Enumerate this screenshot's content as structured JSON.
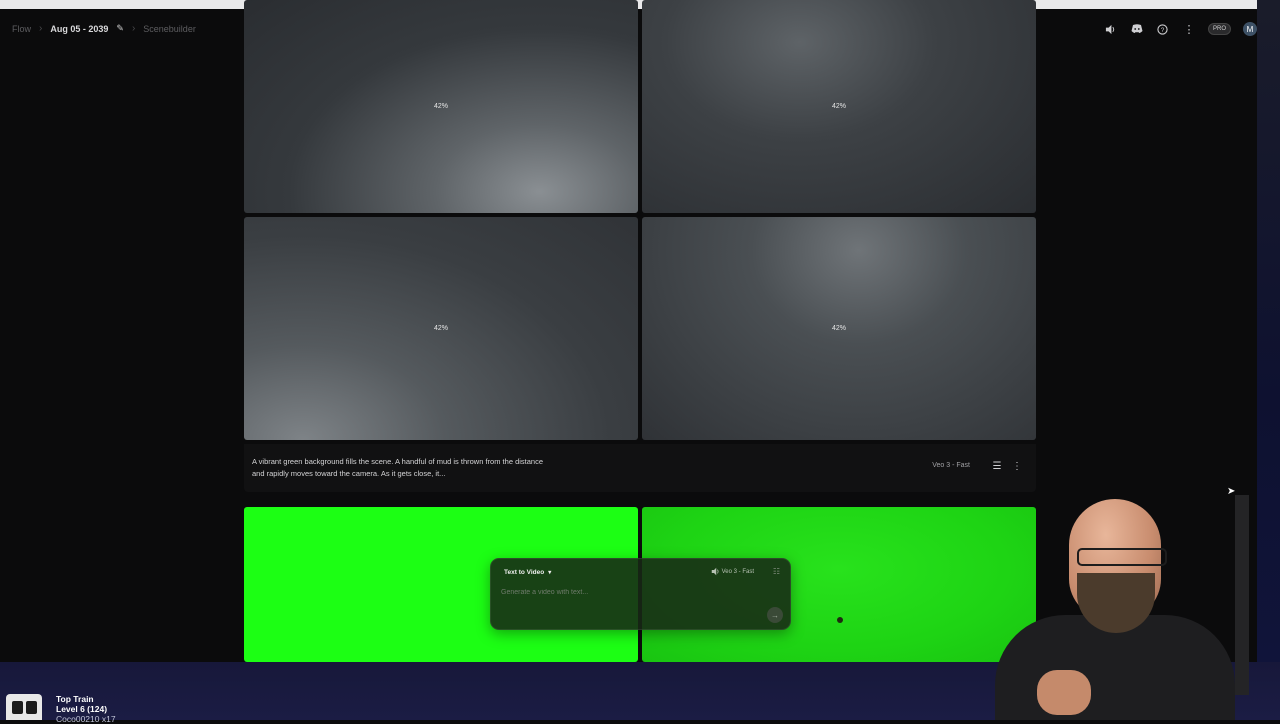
{
  "header": {
    "breadcrumb": [
      "Flow",
      "Aug 05 - 2039",
      "Scenebuilder"
    ],
    "pro_badge": "PRO",
    "avatar_initial": "M",
    "icons": [
      "volume-icon",
      "discord-icon",
      "help-icon",
      "more-vertical-icon"
    ]
  },
  "generation_1": {
    "tiles": [
      {
        "progress_label": "42%"
      },
      {
        "progress_label": "42%"
      },
      {
        "progress_label": "42%"
      },
      {
        "progress_label": "42%"
      }
    ],
    "prompt": "A vibrant green background fills the scene. A handful of mud is thrown from the distance and rapidly moves toward the camera. As it gets close, it...",
    "model": "Veo 3 - Fast"
  },
  "composer": {
    "mode": "Text to Video",
    "model": "Veo 3 - Fast",
    "placeholder": "Generate a video with text..."
  },
  "stream_overlay": {
    "line1": "Top Train",
    "line2": "Level 6  (124)",
    "line3": "Coco00210 x17"
  },
  "colors": {
    "page_bg": "#0b0b0c",
    "green_screen": "#1cff14",
    "overlay_bar": "#17183a"
  }
}
